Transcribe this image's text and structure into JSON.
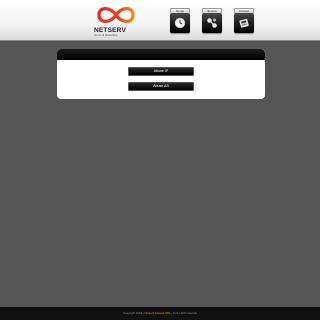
{
  "brand": {
    "name": "NETSERV",
    "tagline": "Servizi di Networking"
  },
  "nav": [
    {
      "label": "Home",
      "icon": "clock-icon"
    },
    {
      "label": "Source",
      "icon": "network-icon"
    },
    {
      "label": "Contact",
      "icon": "phone-icon"
    }
  ],
  "panel": {
    "buttons": [
      {
        "label": "Abuse IP"
      },
      {
        "label": "Abuse AS"
      }
    ]
  },
  "footer": {
    "prefix": "Copyright 2013 -",
    "brand": "Netserv Consult SRL",
    "suffix": "- Tutti i diritti riservati"
  },
  "colors": {
    "background": "#555555",
    "logo_red": "#e8281e",
    "logo_orange": "#f08a1c",
    "footer_brand": "#e8a200"
  }
}
